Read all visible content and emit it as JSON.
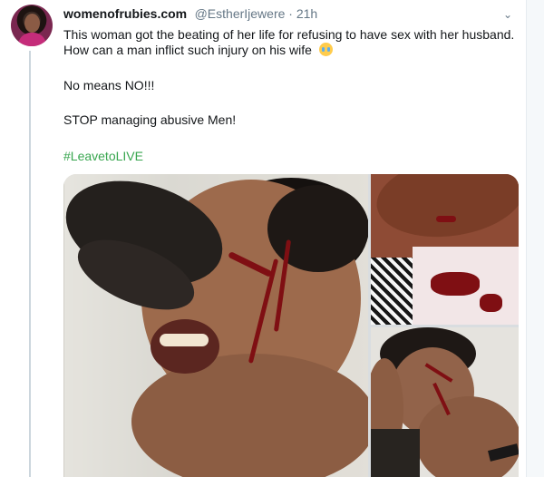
{
  "tweet": {
    "display_name": "womenofrubies.com",
    "handle_time": "@EstherIjewere · 21h",
    "text_line_1": "This woman got the beating of her life  for refusing to have sex with her husband.",
    "text_line_2": "How can a man inflict such injury on his wife",
    "text_line_3": "No means NO!!!",
    "text_line_4": "STOP managing abusive Men!",
    "hashtag": "#LeavetoLIVE",
    "emoji_name": "loudly-crying-face-emoji",
    "accent_color": "#38a64f",
    "icons": {
      "menu": "chevron-down-icon"
    }
  },
  "media": {
    "photo_count": 3
  }
}
